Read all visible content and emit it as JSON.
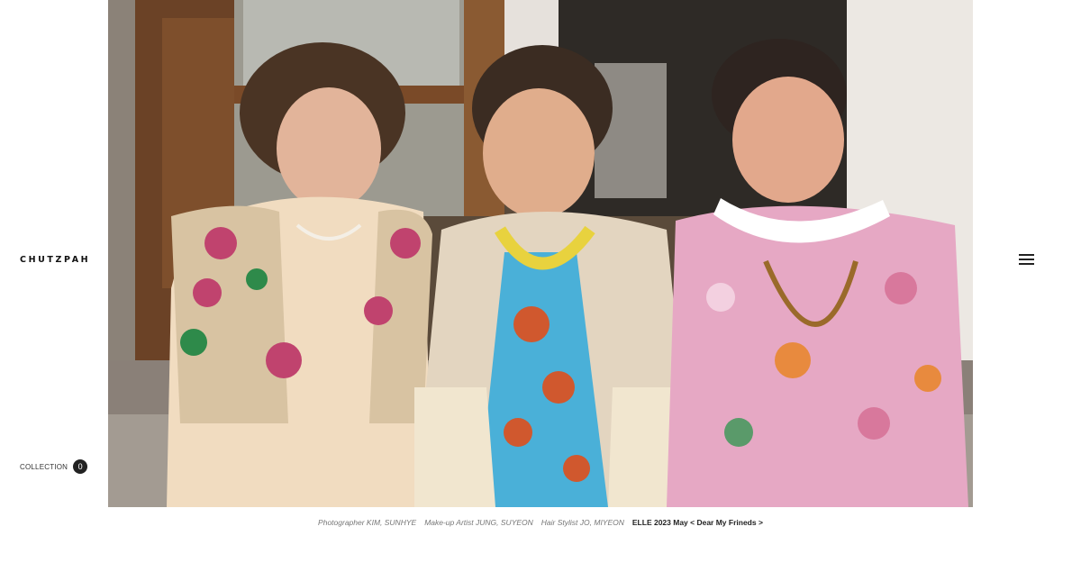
{
  "brand": {
    "name": "CHUTZPAH"
  },
  "menu": {
    "icon": "hamburger-menu-icon"
  },
  "collection": {
    "label": "COLLECTION",
    "count": "0"
  },
  "photo": {
    "subject": "portrait-photo"
  },
  "caption": {
    "photographer": "Photographer KIM, SUNHYE",
    "makeup": "Make-up Artist JUNG, SUYEON",
    "hair": "Hair Stylist JO, MIYEON",
    "title": "ELLE 2023 May < Dear My Frineds >"
  }
}
